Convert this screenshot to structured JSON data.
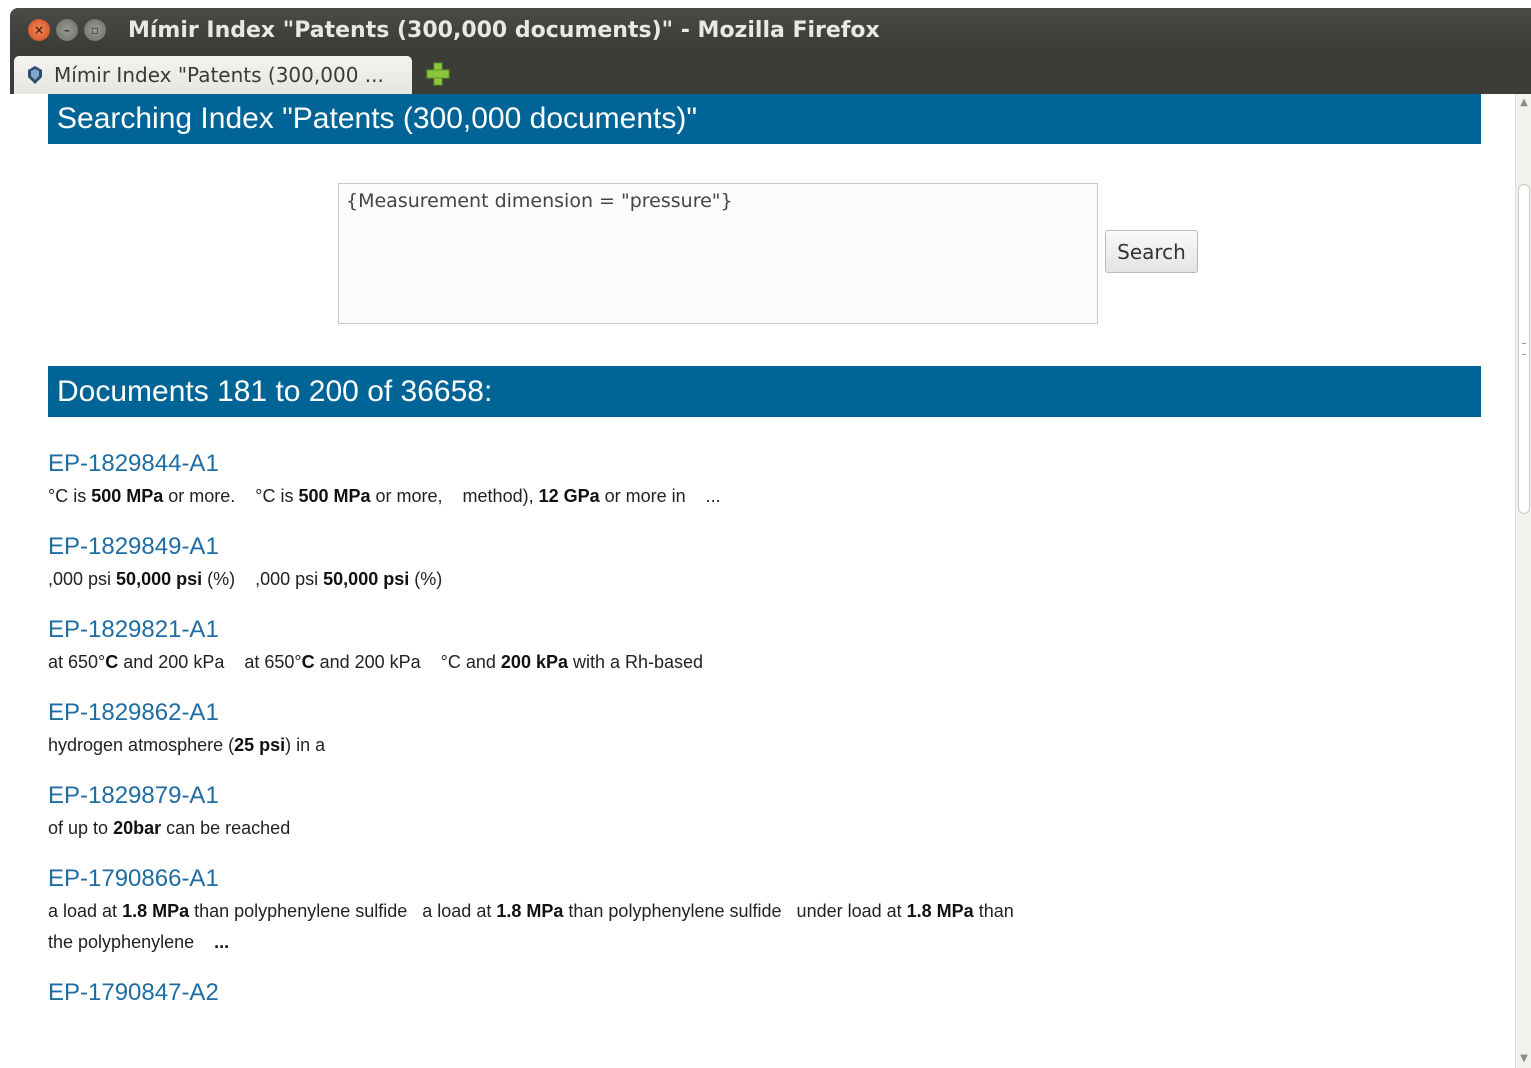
{
  "window": {
    "title": "Mímir Index \"Patents (300,000 documents)\" - Mozilla Firefox"
  },
  "tabs": [
    {
      "label": "Mímir Index \"Patents (300,000 ..."
    }
  ],
  "page": {
    "heading": "Searching Index \"Patents (300,000 documents)\"",
    "query": "{Measurement dimension = \"pressure\"}",
    "search_button": "Search",
    "results_heading": "Documents 181 to 200 of 36658:"
  },
  "results": [
    {
      "id": "EP-1829844-A1",
      "snippet": [
        {
          "text": "°C is ",
          "bold": false
        },
        {
          "text": "500 MPa",
          "bold": true
        },
        {
          "text": " or more.    °C is ",
          "bold": false
        },
        {
          "text": "500 MPa",
          "bold": true
        },
        {
          "text": " or more,    method), ",
          "bold": false
        },
        {
          "text": "12 GPa",
          "bold": true
        },
        {
          "text": " or more in    ...",
          "bold": false
        }
      ]
    },
    {
      "id": "EP-1829849-A1",
      "snippet": [
        {
          "text": ",000 psi ",
          "bold": false
        },
        {
          "text": "50,000 psi",
          "bold": true
        },
        {
          "text": " (%)    ,000 psi ",
          "bold": false
        },
        {
          "text": "50,000 psi",
          "bold": true
        },
        {
          "text": " (%)",
          "bold": false
        }
      ]
    },
    {
      "id": "EP-1829821-A1",
      "snippet": [
        {
          "text": "at 650°",
          "bold": false
        },
        {
          "text": "C",
          "bold": true
        },
        {
          "text": " and 200 kPa    at 650°",
          "bold": false
        },
        {
          "text": "C",
          "bold": true
        },
        {
          "text": " and 200 kPa    °C and ",
          "bold": false
        },
        {
          "text": "200 kPa",
          "bold": true
        },
        {
          "text": " with a Rh-based",
          "bold": false
        }
      ]
    },
    {
      "id": "EP-1829862-A1",
      "snippet": [
        {
          "text": "hydrogen atmosphere (",
          "bold": false
        },
        {
          "text": "25 psi",
          "bold": true
        },
        {
          "text": ") in a",
          "bold": false
        }
      ]
    },
    {
      "id": "EP-1829879-A1",
      "snippet": [
        {
          "text": "of up to ",
          "bold": false
        },
        {
          "text": "20bar",
          "bold": true
        },
        {
          "text": " can be reached",
          "bold": false
        }
      ]
    },
    {
      "id": "EP-1790866-A1",
      "snippet": [
        {
          "text": "a load at ",
          "bold": false
        },
        {
          "text": "1.8 MPa",
          "bold": true
        },
        {
          "text": " than polyphenylene sulfide   a load at ",
          "bold": false
        },
        {
          "text": "1.8 MPa",
          "bold": true
        },
        {
          "text": " than polyphenylene sulfide   under load at ",
          "bold": false
        },
        {
          "text": "1.8 MPa",
          "bold": true
        },
        {
          "text": " than\nthe polyphenylene    ",
          "bold": false
        },
        {
          "text": "...",
          "bold": true
        }
      ]
    },
    {
      "id": "EP-1790847-A2",
      "snippet": []
    }
  ],
  "colors": {
    "header_bg": "#006496",
    "link": "#1f6ca3",
    "titlebar": "#3a3a37"
  },
  "icons": {
    "close": "close-icon",
    "minimize": "minimize-icon",
    "maximize": "maximize-icon",
    "favicon": "favicon-icon",
    "new_tab": "plus-icon"
  }
}
